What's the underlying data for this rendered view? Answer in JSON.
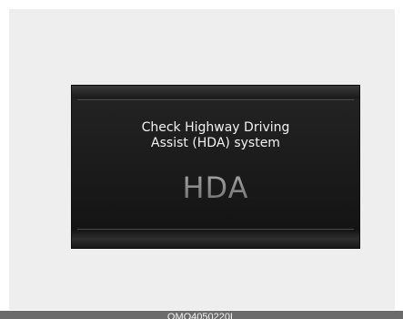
{
  "display": {
    "message_line1": "Check Highway Driving",
    "message_line2": "Assist (HDA) system",
    "indicator": "HDA"
  },
  "caption": {
    "code": "OMQ4050220L"
  },
  "colors": {
    "page_background": "#eeeeee",
    "display_background": "#1b1b1b",
    "message_text": "#f2f2f2",
    "indicator_text": "#8e8e8e",
    "caption_bar": "#6b6b6b"
  }
}
